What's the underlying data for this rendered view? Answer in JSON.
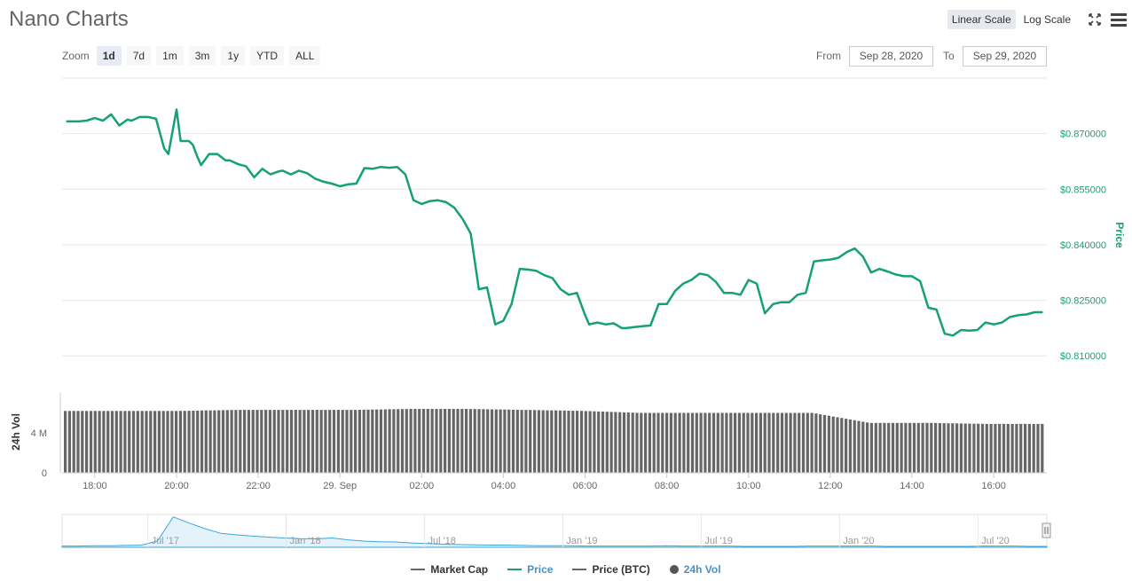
{
  "header": {
    "title": "Nano Charts"
  },
  "scale": {
    "linear": "Linear Scale",
    "log": "Log Scale"
  },
  "zoom": {
    "label": "Zoom",
    "buttons": [
      "1d",
      "7d",
      "1m",
      "3m",
      "1y",
      "YTD",
      "ALL"
    ],
    "active": "1d"
  },
  "range": {
    "from_label": "From",
    "from_value": "Sep 28, 2020",
    "to_label": "To",
    "to_value": "Sep 29, 2020"
  },
  "legend": [
    {
      "name": "Market Cap",
      "color": "#666666",
      "kind": "line"
    },
    {
      "name": "Price",
      "color": "#1b9e77",
      "kind": "line"
    },
    {
      "name": "Price (BTC)",
      "color": "#666666",
      "kind": "line"
    },
    {
      "name": "24h Vol",
      "color": "#555555",
      "kind": "dot",
      "text_color": "#4a90c8"
    }
  ],
  "colors": {
    "price": "#16a078",
    "volume": "#666666",
    "navigator": "#3aa6dd",
    "grid": "#e6e6e6"
  },
  "chart_data": {
    "type": "line",
    "title": "",
    "x_ticks": [
      "18:00",
      "20:00",
      "22:00",
      "29. Sep",
      "02:00",
      "04:00",
      "06:00",
      "08:00",
      "10:00",
      "12:00",
      "14:00",
      "16:00"
    ],
    "x_ticks_hours": [
      0,
      2,
      4,
      6,
      8,
      10,
      12,
      14,
      16,
      18,
      20,
      22
    ],
    "x_range_hours": [
      -0.8,
      23.3
    ],
    "price_axis": {
      "label": "Price",
      "ticks": [
        "$0.810000",
        "$0.825000",
        "$0.840000",
        "$0.855000",
        "$0.870000"
      ],
      "tick_values": [
        0.81,
        0.825,
        0.84,
        0.855,
        0.87
      ],
      "ylim": [
        0.8,
        0.885
      ]
    },
    "volume_axis": {
      "label": "24h Vol",
      "ticks": [
        "0",
        "4 M"
      ],
      "tick_values": [
        0,
        4000000
      ],
      "ylim": [
        0,
        10000000
      ]
    },
    "series": [
      {
        "name": "Price",
        "x": [
          -0.7,
          -0.4,
          -0.2,
          0.0,
          0.2,
          0.4,
          0.6,
          0.8,
          0.9,
          1.1,
          1.3,
          1.5,
          1.7,
          1.8,
          2.0,
          2.1,
          2.3,
          2.4,
          2.5,
          2.6,
          2.8,
          3.0,
          3.2,
          3.3,
          3.5,
          3.7,
          3.9,
          4.1,
          4.3,
          4.5,
          4.6,
          4.8,
          5.0,
          5.2,
          5.4,
          5.6,
          5.8,
          6.0,
          6.2,
          6.4,
          6.6,
          6.8,
          7.0,
          7.2,
          7.4,
          7.6,
          7.8,
          8.0,
          8.2,
          8.4,
          8.6,
          8.8,
          9.0,
          9.2,
          9.4,
          9.6,
          9.8,
          10.0,
          10.2,
          10.4,
          10.6,
          10.8,
          11.0,
          11.2,
          11.4,
          11.6,
          11.8,
          12.0,
          12.1,
          12.3,
          12.5,
          12.7,
          12.9,
          13.0,
          13.2,
          13.4,
          13.6,
          13.8,
          14.0,
          14.2,
          14.4,
          14.6,
          14.8,
          15.0,
          15.2,
          15.4,
          15.6,
          15.8,
          16.0,
          16.2,
          16.4,
          16.6,
          16.8,
          17.0,
          17.2,
          17.4,
          17.6,
          17.8,
          18.0,
          18.2,
          18.4,
          18.6,
          18.8,
          19.0,
          19.2,
          19.4,
          19.6,
          19.8,
          20.0,
          20.2,
          20.4,
          20.6,
          20.8,
          21.0,
          21.2,
          21.4,
          21.6,
          21.8,
          22.0,
          22.2,
          22.4,
          22.6,
          22.8,
          23.0,
          23.2
        ],
        "values": [
          0.8733,
          0.8733,
          0.8735,
          0.8742,
          0.8735,
          0.8752,
          0.8722,
          0.8738,
          0.8735,
          0.8745,
          0.8745,
          0.874,
          0.866,
          0.8645,
          0.8765,
          0.868,
          0.868,
          0.867,
          0.864,
          0.8615,
          0.8645,
          0.8645,
          0.8628,
          0.8628,
          0.8618,
          0.8612,
          0.8582,
          0.8605,
          0.859,
          0.8598,
          0.86,
          0.859,
          0.86,
          0.8593,
          0.8578,
          0.857,
          0.8565,
          0.8558,
          0.8563,
          0.8565,
          0.8607,
          0.8605,
          0.861,
          0.8608,
          0.861,
          0.859,
          0.852,
          0.851,
          0.8518,
          0.852,
          0.8515,
          0.85,
          0.847,
          0.843,
          0.828,
          0.8285,
          0.8185,
          0.8195,
          0.824,
          0.8335,
          0.8333,
          0.833,
          0.8318,
          0.831,
          0.828,
          0.8265,
          0.827,
          0.821,
          0.8185,
          0.819,
          0.8185,
          0.8188,
          0.8175,
          0.8175,
          0.8178,
          0.818,
          0.8182,
          0.824,
          0.824,
          0.8275,
          0.8295,
          0.8305,
          0.8322,
          0.8318,
          0.83,
          0.827,
          0.827,
          0.8265,
          0.8305,
          0.8295,
          0.8215,
          0.824,
          0.8245,
          0.8245,
          0.8265,
          0.827,
          0.8355,
          0.8358,
          0.836,
          0.8365,
          0.838,
          0.839,
          0.8368,
          0.8325,
          0.8335,
          0.8328,
          0.832,
          0.8315,
          0.8315,
          0.8302,
          0.823,
          0.8225,
          0.816,
          0.8155,
          0.817,
          0.8168,
          0.817,
          0.819,
          0.8185,
          0.819,
          0.8205,
          0.821,
          0.8212,
          0.8218,
          0.8218
        ]
      }
    ],
    "volume": {
      "name": "24h Vol",
      "count": 230,
      "values_millions": [
        6.2,
        6.2,
        6.2,
        6.3,
        6.3,
        6.3,
        6.4,
        6.4,
        6.3,
        6.2,
        6.0,
        6.0,
        6.0,
        6.0,
        5.0,
        5.0,
        4.9,
        4.9
      ]
    },
    "navigator": {
      "ticks": [
        "Jul '17",
        "Jan '18",
        "Jul '18",
        "Jan '19",
        "Jul '19",
        "Jan '20",
        "Jul '20"
      ],
      "values": [
        0.04,
        0.04,
        0.05,
        0.05,
        0.06,
        0.07,
        0.2,
        0.98,
        0.78,
        0.6,
        0.45,
        0.4,
        0.36,
        0.33,
        0.3,
        0.28,
        0.27,
        0.3,
        0.24,
        0.2,
        0.18,
        0.17,
        0.14,
        0.12,
        0.1,
        0.09,
        0.08,
        0.07,
        0.07,
        0.06,
        0.05,
        0.05,
        0.05,
        0.04,
        0.04,
        0.04,
        0.04,
        0.04,
        0.05,
        0.04,
        0.04,
        0.04,
        0.04,
        0.03,
        0.03,
        0.03,
        0.03,
        0.04,
        0.04,
        0.04,
        0.04,
        0.04,
        0.03,
        0.03,
        0.03,
        0.03,
        0.03,
        0.03,
        0.04,
        0.04,
        0.04,
        0.03,
        0.03
      ]
    }
  }
}
